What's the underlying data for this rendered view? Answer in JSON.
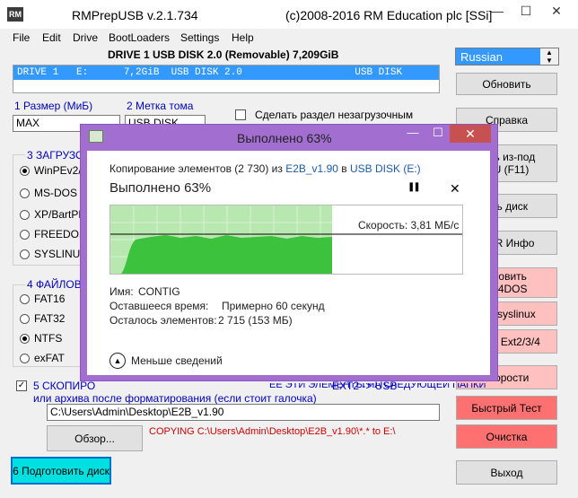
{
  "app": {
    "icon_label": "RM",
    "title": "RMPrepUSB v.2.1.734",
    "copyright": "(c)2008-2016 RM Education plc [SSi]"
  },
  "window_controls": {
    "minimize": "—",
    "maximize": "☐",
    "close": "✕"
  },
  "menu": [
    "File",
    "Edit",
    "Drive",
    "BootLoaders",
    "Settings",
    "Help"
  ],
  "drive": {
    "title": "DRIVE 1 USB DISK 2.0  (Removable) 7,209GiB",
    "row": "DRIVE 1   E:      7,2GiB  USB DISK 2.0                   USB DISK"
  },
  "language": {
    "selected": "Russian"
  },
  "right_buttons": {
    "refresh": "Обновить",
    "help": "Справка",
    "qemu": "тить из-под\nMU (F11)",
    "eject": "ечь диск",
    "mbr": "MBR Инфо",
    "grub4dos": "ановить\nub4DOS",
    "syslinux": "ить syslinux",
    "ext": "ь ФС Ext2/3/4",
    "speed": "скорости",
    "quick_test": "Быстрый Тест",
    "clean": "Очистка",
    "exit": "Выход"
  },
  "form": {
    "size_label": "1 Размер (МиБ)",
    "size_value": "MAX",
    "volume_label": "2 Метка тома",
    "volume_value": "USB DISK",
    "nonboot_label": "Сделать раздел незагрузочным",
    "boot_group": "3 ЗАГРУЗО",
    "boot_options": [
      "WinPEv2/",
      "MS-DOS b",
      "XP/BartPE",
      "FREEDOS",
      "SYSLINUX"
    ],
    "fs_group": "4 ФАЙЛОВ",
    "fs_options": [
      "FAT16",
      "FAT32",
      "NTFS",
      "exFAT"
    ],
    "copy_label_1": "5 СКОПИРО",
    "copy_label_tail": "ЕЕ ЭТИ ЭЛЕМЕНТЫ НА СЛЕДУЮЩЕЙ ПАПКИ",
    "copy_label_2": "или архива после форматирования (если стоит галочка)",
    "path_value": "C:\\Users\\Admin\\Desktop\\E2B_v1.90",
    "browse": "Обзор...",
    "copying_status": "COPYING C:\\Users\\Admin\\Desktop\\E2B_v1.90\\*.* to E:\\",
    "ext_tail": "EXT2 -> USB",
    "prepare": "6 Подготовить диск"
  },
  "dialog": {
    "title": "Выполнено 63%",
    "copy_prefix": "Копирование элементов (2 730) из ",
    "source": "E2B_v1.90",
    "in_word": " в ",
    "dest": "USB DISK (E:)",
    "percent_heading": "Выполнено 63%",
    "pause": "❚❚",
    "cancel": "✕",
    "speed": "Скорость: 3,81 МБ/с",
    "progress_fraction": 0.63,
    "name_label": "Имя:",
    "name_value": "CONTIG",
    "time_label": "Оставшееся время:",
    "time_value": "Примерно 60 секунд",
    "items_label": "Осталось элементов:",
    "items_value": "2 715 (153 МБ)",
    "less_details": "Меньше сведений"
  },
  "colors": {
    "accent_purple": "#a26fd0",
    "selection_blue": "#3399ff",
    "progress_green": "#3cc23c",
    "button_pink": "#ffc0c0",
    "button_red": "#ff7070",
    "prepare_cyan": "#00e0e0"
  }
}
